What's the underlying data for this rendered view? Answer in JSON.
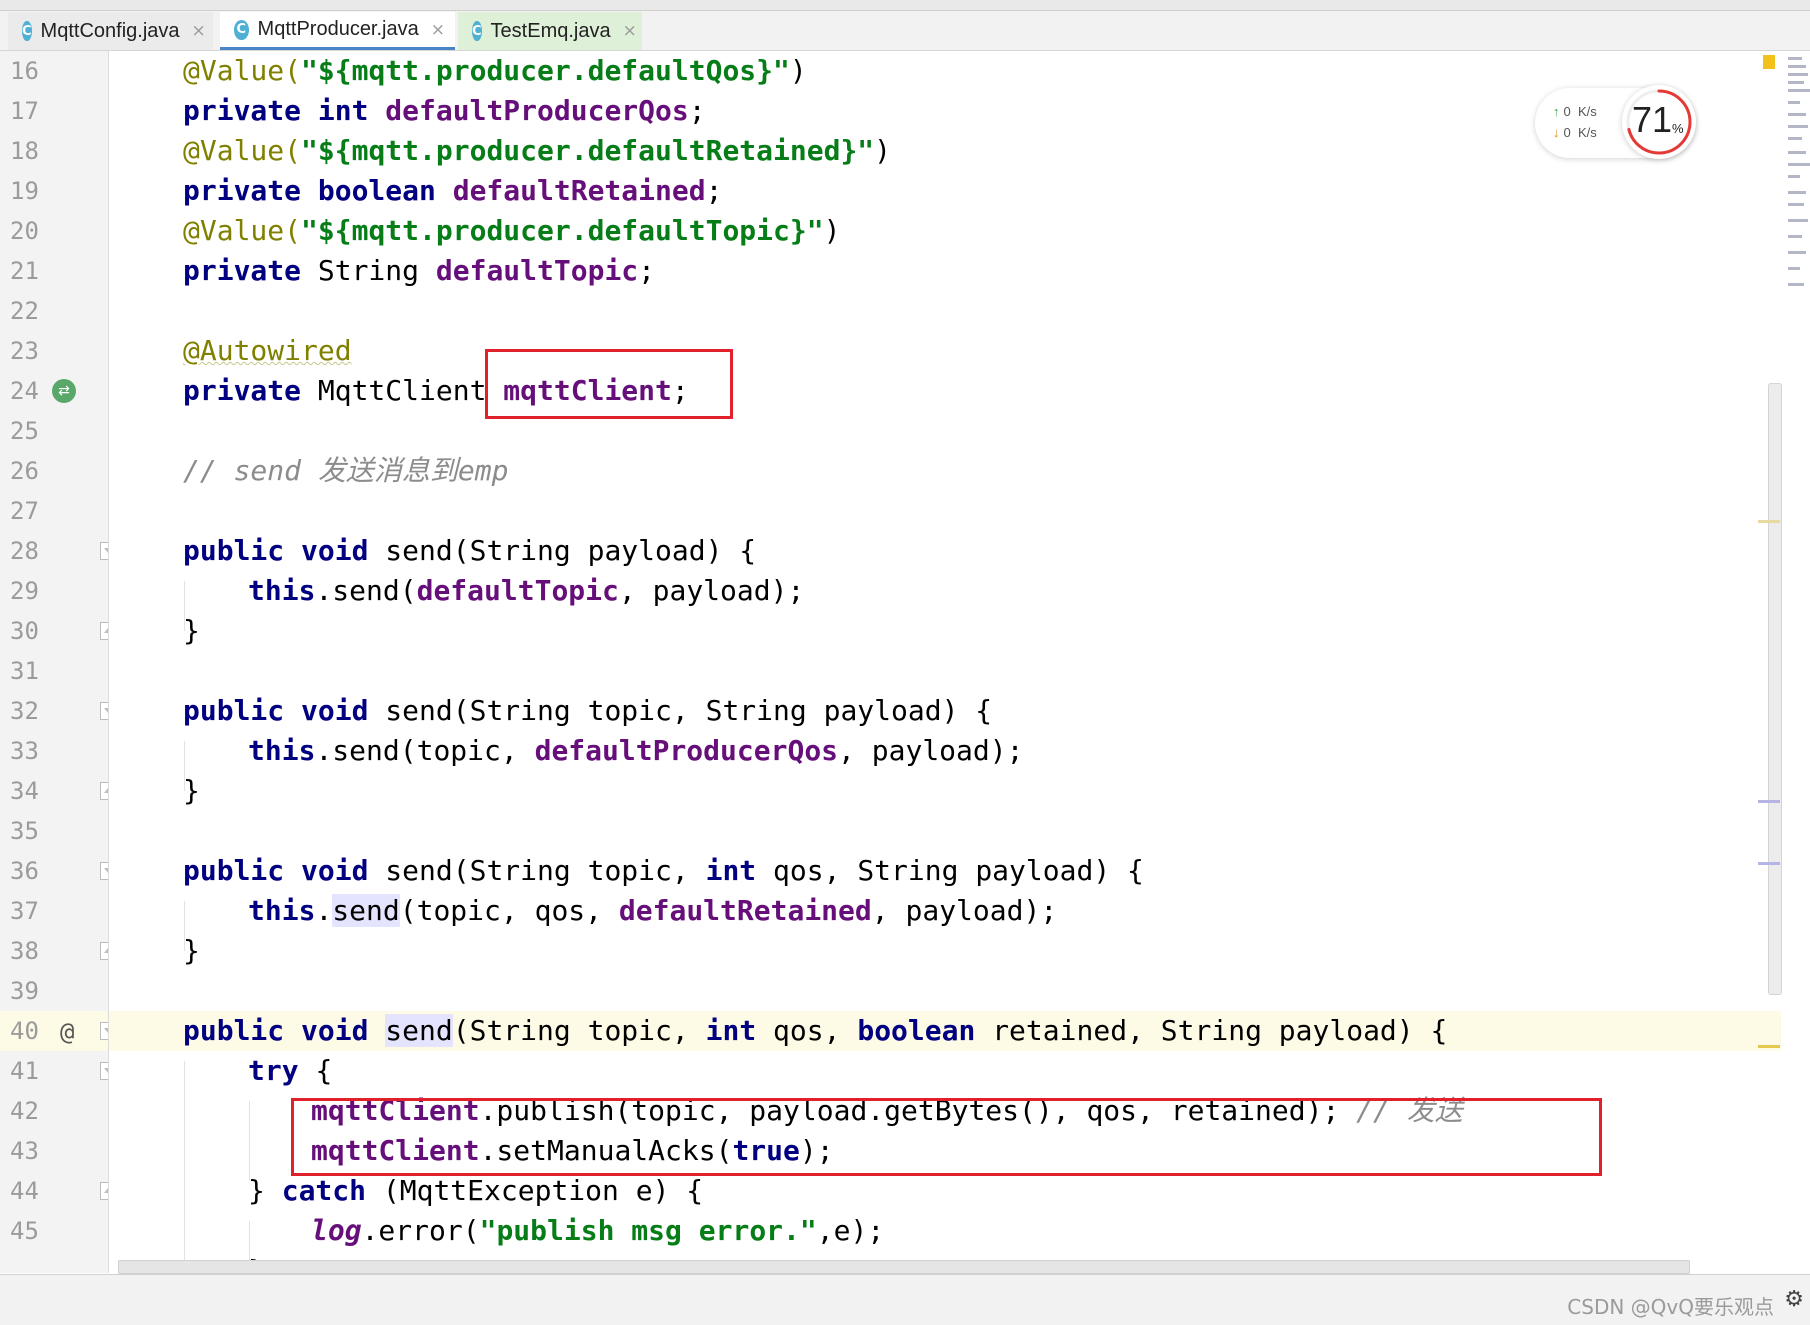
{
  "tabs": [
    {
      "label": "MqttConfig.java",
      "icon": "C",
      "active": false
    },
    {
      "label": "MqttProducer.java",
      "icon": "C",
      "active": true
    },
    {
      "label": "TestEmq.java",
      "icon": "C",
      "active": false
    }
  ],
  "gutter": {
    "line_numbers": [
      "16",
      "17",
      "18",
      "19",
      "20",
      "21",
      "22",
      "23",
      "24",
      "25",
      "26",
      "27",
      "28",
      "29",
      "30",
      "31",
      "32",
      "33",
      "34",
      "35",
      "36",
      "37",
      "38",
      "39",
      "40",
      "41",
      "42",
      "43",
      "44",
      "45"
    ],
    "override_marker": "@"
  },
  "code": {
    "l16": {
      "a": "@Value(",
      "s": "\"${mqtt.producer.defaultQos}\"",
      "b": ")"
    },
    "l17": {
      "k": "private int ",
      "f": "defaultProducerQos",
      "e": ";"
    },
    "l18": {
      "a": "@Value(",
      "s": "\"${mqtt.producer.defaultRetained}\"",
      "b": ")"
    },
    "l19": {
      "k": "private boolean ",
      "f": "defaultRetained",
      "e": ";"
    },
    "l20": {
      "a": "@Value(",
      "s": "\"${mqtt.producer.defaultTopic}\"",
      "b": ")"
    },
    "l21": {
      "k": "private ",
      "t": "String ",
      "f": "defaultTopic",
      "e": ";"
    },
    "l23": {
      "a": "@Autowired"
    },
    "l24": {
      "k": "private ",
      "t": "MqttClient ",
      "f": "mqttClient",
      "e": ";"
    },
    "l26": {
      "c": "// send 发送消息到emp"
    },
    "l28": {
      "k": "public void ",
      "t": "send(String payload) {"
    },
    "l29": {
      "k": "this",
      "t": ".send(",
      "f": "defaultTopic",
      "e": ", payload);"
    },
    "l30": {
      "t": "}"
    },
    "l32": {
      "k": "public void ",
      "t": "send(String topic, String payload) {"
    },
    "l33": {
      "k": "this",
      "t": ".send(topic, ",
      "f": "defaultProducerQos",
      "e": ", payload);"
    },
    "l34": {
      "t": "}"
    },
    "l36": {
      "k": "public void ",
      "t": "send(String topic, ",
      "k2": "int ",
      "t2": "qos, String payload) {"
    },
    "l37": {
      "k": "this",
      "t": ".",
      "h": "send",
      "t2": "(topic, qos, ",
      "f": "defaultRetained",
      "e": ", payload);"
    },
    "l38": {
      "t": "}"
    },
    "l40": {
      "k": "public void ",
      "h": "send",
      "t": "(String topic, ",
      "k2": "int ",
      "t2": "qos, ",
      "k3": "boolean ",
      "t3": "retained, String payload) {"
    },
    "l41": {
      "k": "try ",
      "t": "{"
    },
    "l42": {
      "f": "mqttClient",
      "t": ".publish(topic, payload.getBytes(), qos, retained); ",
      "c": "// 发送"
    },
    "l43": {
      "f": "mqttClient",
      "t": ".setManualAcks(",
      "k": "true",
      "e": ");"
    },
    "l44": {
      "t": "} ",
      "k": "catch ",
      "t2": "(MqttException e) {"
    },
    "l45": {
      "g": "log",
      "t": ".error(",
      "s": "\"publish msg error.\"",
      "e": ",e);"
    },
    "l46": {
      "t": "}"
    }
  },
  "network": {
    "up_value": "0",
    "up_unit": "K/s",
    "down_value": "0",
    "down_unit": "K/s"
  },
  "gauge": {
    "value": "71",
    "unit": "%",
    "fraction": 0.71
  },
  "watermark": "CSDN @QvQ要乐观点",
  "colors": {
    "keyword": "#000080",
    "field": "#660e7a",
    "string": "#067d17",
    "annotation": "#808000",
    "comment": "#8c8c8c",
    "highlight_box": "#e0202a",
    "current_line": "#fdfbe6"
  }
}
